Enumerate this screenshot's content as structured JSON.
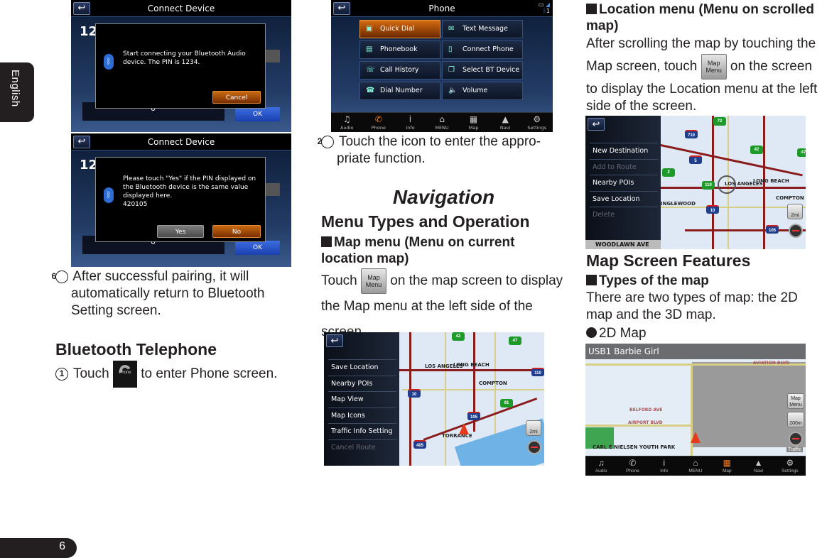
{
  "side_tab": {
    "label": "English"
  },
  "page_number": "6",
  "left_column": {
    "screen1": {
      "title": "Connect Device",
      "back_icon": "back-arrow-icon",
      "pin_partial": "12",
      "message": "Start connecting your Bluetooth Audio device.  The PIN is 1234.",
      "cancel_label": "Cancel",
      "keypad_digit": "0",
      "ok_label": "OK"
    },
    "screen2": {
      "title": "Connect Device",
      "pin_partial": "12",
      "message": "Please touch \"Yes\" if the PIN displayed on the Bluetooth device is the same value displayed here.",
      "pin_value": "420105",
      "yes_label": "Yes",
      "no_label": "No",
      "keypad_digit": "0",
      "ok_label": "OK"
    },
    "step6_num": "6",
    "step6_text": "After successful pairing, it will automatically return to Bluetooth Setting screen.",
    "bt_heading": "Bluetooth Telephone",
    "step1_num": "1",
    "step1_before": "Touch",
    "step1_icon_caption": "Phone",
    "step1_after": "to enter Phone screen."
  },
  "middle_column": {
    "phone_screen": {
      "title": "Phone",
      "status_bt_count": "1",
      "menu": [
        {
          "label": "Quick Dial",
          "icon": "quick-dial-icon",
          "selected": true
        },
        {
          "label": "Text Message",
          "icon": "envelope-icon",
          "selected": false
        },
        {
          "label": "Phonebook",
          "icon": "phonebook-icon",
          "selected": false
        },
        {
          "label": "Connect Phone",
          "icon": "connect-phone-icon",
          "selected": false
        },
        {
          "label": "Call History",
          "icon": "call-history-icon",
          "selected": false
        },
        {
          "label": "Select BT Device",
          "icon": "bt-device-icon",
          "selected": false
        },
        {
          "label": "Dial Number",
          "icon": "dial-number-icon",
          "selected": false
        },
        {
          "label": "Volume",
          "icon": "volume-icon",
          "selected": false
        }
      ],
      "bottom_bar": [
        "Audio",
        "Phone",
        "Info",
        "MENU",
        "Map",
        "Navi",
        "Settings"
      ],
      "active_tab": "Phone"
    },
    "step2_num": "2",
    "step2_text": "Touch the icon to enter the appro-priate function.",
    "nav_title": "Navigation",
    "menu_types_heading": "Menu Types and Operation",
    "map_menu_heading": "Map menu (Menu on current location map)",
    "map_menu_before": "Touch",
    "map_menu_btn": [
      "Map",
      "Menu"
    ],
    "map_menu_after": "on the map screen to display the Map menu at the left side of the screen.",
    "map_menu_screen": {
      "items": [
        {
          "label": "Save Location",
          "enabled": true
        },
        {
          "label": "Nearby POIs",
          "enabled": true
        },
        {
          "label": "Map View",
          "enabled": true
        },
        {
          "label": "Map Icons",
          "enabled": true
        },
        {
          "label": "Traffic Info Setting",
          "enabled": true
        },
        {
          "label": "Cancel Route",
          "enabled": false
        }
      ],
      "places": [
        "LOS ANGELES",
        "LONG BEACH",
        "COMPTON",
        "TORRANCE"
      ],
      "shields": [
        "42",
        "47",
        "110",
        "10",
        "91",
        "105",
        "405"
      ],
      "scale": "2mi"
    }
  },
  "right_column": {
    "location_menu_heading": "Location menu (Menu on scrolled map)",
    "location_before": "After scrolling the map by touching the Map screen, touch",
    "location_after": "on the screen to display the Location menu at the left side of the screen.",
    "location_menu_screen": {
      "items": [
        {
          "label": "New Destination",
          "enabled": true
        },
        {
          "label": "Add to Route",
          "enabled": false
        },
        {
          "label": "Nearby POIs",
          "enabled": true
        },
        {
          "label": "Save Location",
          "enabled": true
        },
        {
          "label": "Delete",
          "enabled": false
        }
      ],
      "street": "WOODLAWN AVE",
      "places": [
        "LOS ANGELES",
        "LONG BEACH",
        "COMPTON",
        "INGLEWOOD"
      ],
      "shields": [
        "72",
        "710",
        "42",
        "5",
        "2",
        "110",
        "10",
        "105",
        "47"
      ],
      "scale": "2mi"
    },
    "map_features_heading": "Map Screen Features",
    "types_heading": "Types of the map",
    "types_text": "There are two types of map: the 2D map and the 3D map.",
    "map2d_label": "2D Map",
    "map2d_screen": {
      "now_playing": "USB1 Barbie Girl",
      "streets": [
        "BELFORD AVE",
        "AIRPORT BLVD",
        "AVIATION BLVD"
      ],
      "park": "CARL E NIELSEN YOUTH PARK",
      "map_menu_btn": [
        "Map",
        "Menu"
      ],
      "scale": "200m",
      "traffic_label": "Traffic",
      "bottom_bar": [
        "Audio",
        "Phone",
        "Info",
        "MENU",
        "Map",
        "Navi",
        "Settings"
      ],
      "active_tab": "Map"
    }
  }
}
